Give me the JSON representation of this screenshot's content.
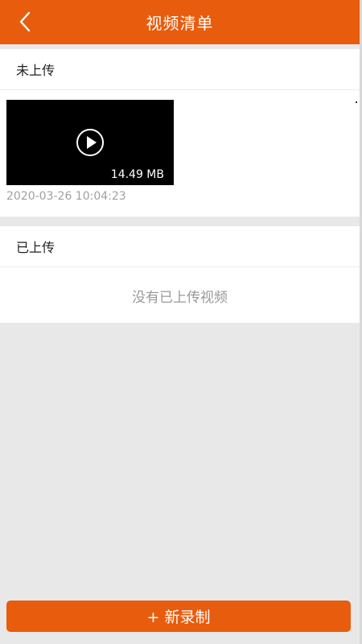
{
  "header": {
    "title": "视频清单",
    "back_icon": "chevron-left-icon"
  },
  "pending_section": {
    "title": "未上传",
    "videos": [
      {
        "size": "14.49 MB",
        "timestamp": "2020-03-26 10:04:23",
        "icon": "play-circle-icon"
      }
    ]
  },
  "uploaded_section": {
    "title": "已上传",
    "empty_text": "没有已上传视频"
  },
  "footer": {
    "new_record_label": "+ 新录制"
  },
  "colors": {
    "accent": "#e85c0d",
    "background": "#e8e8e8",
    "card": "#ffffff",
    "muted_text": "#a0a0a0"
  }
}
